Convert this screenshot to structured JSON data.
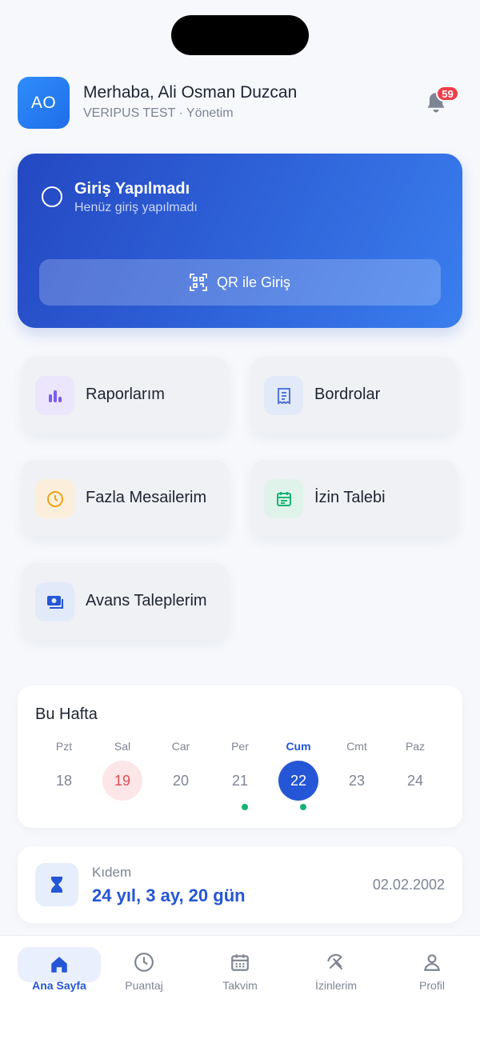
{
  "header": {
    "avatar_initials": "AO",
    "greeting": "Merhaba, Ali Osman Duzcan",
    "subtitle": "VERIPUS TEST · Yönetim",
    "notification_count": "59"
  },
  "login_card": {
    "title": "Giriş Yapılmadı",
    "subtitle": "Henüz giriş yapılmadı",
    "qr_button_label": "QR ile Giriş"
  },
  "quick_actions": [
    {
      "label": "Raporlarım",
      "icon": "bar-chart-icon",
      "color": "#7c5cf0"
    },
    {
      "label": "Bordrolar",
      "icon": "receipt-icon",
      "color": "#3f6ad8"
    },
    {
      "label": "Fazla Mesailerim",
      "icon": "clock-icon",
      "color": "#f0a21a"
    },
    {
      "label": "İzin Talebi",
      "icon": "calendar-icon",
      "color": "#16b474"
    },
    {
      "label": "Avans Taleplerim",
      "icon": "money-icon",
      "color": "#2456d6"
    }
  ],
  "week": {
    "title": "Bu Hafta",
    "days": [
      {
        "name": "Pzt",
        "num": "18",
        "state": "normal",
        "dot": false
      },
      {
        "name": "Sal",
        "num": "19",
        "state": "red",
        "dot": false
      },
      {
        "name": "Car",
        "num": "20",
        "state": "normal",
        "dot": false
      },
      {
        "name": "Per",
        "num": "21",
        "state": "normal",
        "dot": true
      },
      {
        "name": "Cum",
        "num": "22",
        "state": "active",
        "dot": true
      },
      {
        "name": "Cmt",
        "num": "23",
        "state": "normal",
        "dot": false
      },
      {
        "name": "Paz",
        "num": "24",
        "state": "normal",
        "dot": false
      }
    ]
  },
  "seniority": {
    "label": "Kıdem",
    "value": "24 yıl, 3 ay, 20 gün",
    "start_date": "02.02.2002"
  },
  "nav": [
    {
      "label": "Ana Sayfa",
      "icon": "home-icon",
      "active": true
    },
    {
      "label": "Puantaj",
      "icon": "clock-icon",
      "active": false
    },
    {
      "label": "Takvim",
      "icon": "calendar-icon",
      "active": false
    },
    {
      "label": "İzinlerim",
      "icon": "beach-umbrella-icon",
      "active": false
    },
    {
      "label": "Profil",
      "icon": "person-icon",
      "active": false
    }
  ],
  "colors": {
    "accent": "#2456d6",
    "danger": "#ef3e4a",
    "success": "#16b474"
  }
}
